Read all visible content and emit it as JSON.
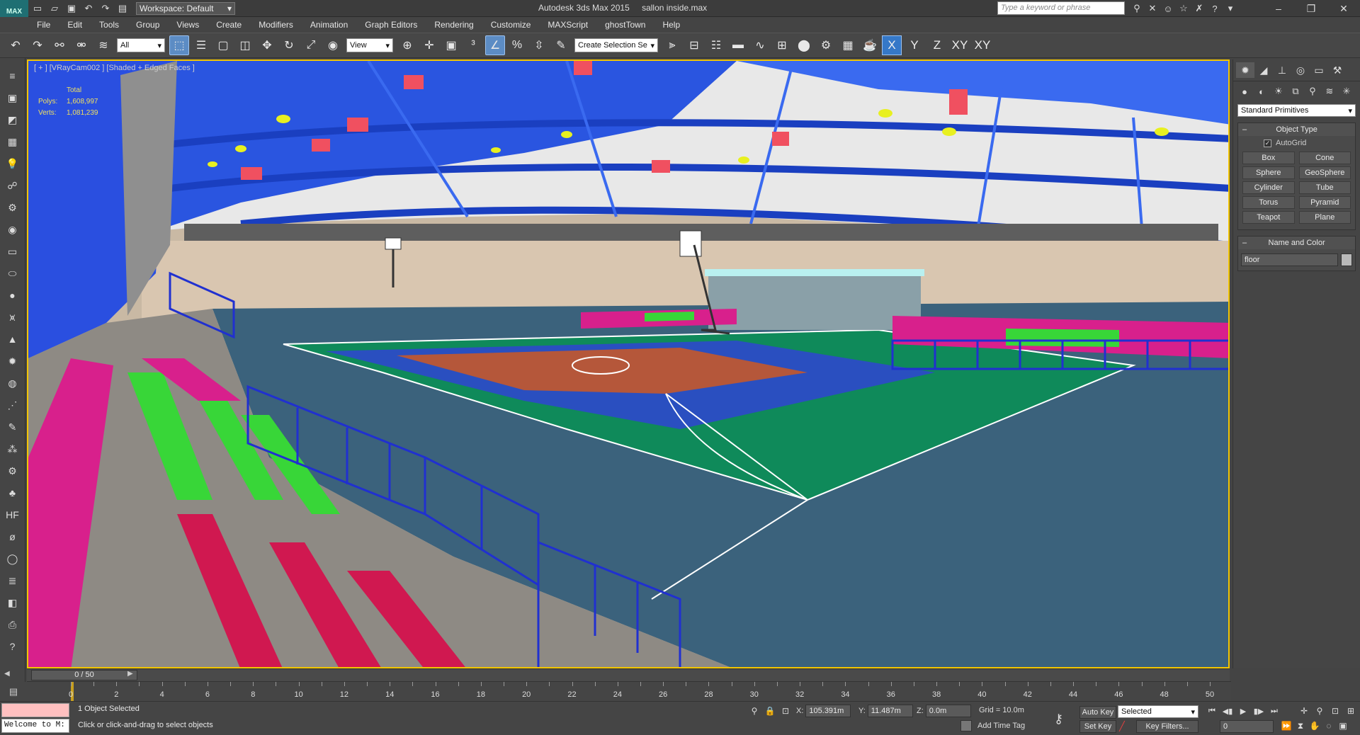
{
  "titlebar": {
    "workspace": "Workspace: Default",
    "app_title": "Autodesk 3ds Max 2015",
    "file_name": "sallon inside.max",
    "search_placeholder": "Type a keyword or phrase"
  },
  "menus": [
    "File",
    "Edit",
    "Tools",
    "Group",
    "Views",
    "Create",
    "Modifiers",
    "Animation",
    "Graph Editors",
    "Rendering",
    "Customize",
    "MAXScript",
    "ghostTown",
    "Help"
  ],
  "toolbar": {
    "filter_value": "All",
    "ref_coord_value": "View",
    "selection_set_value": "Create Selection Se",
    "axis_x": "X",
    "axis_y": "Y",
    "axis_z": "Z",
    "axis_xy": "XY",
    "axis_xy2": "XY"
  },
  "viewport": {
    "label": "[ + ] [VRayCam002 ] [Shaded + Edged Faces ]",
    "stats_header": "Total",
    "polys_label": "Polys:",
    "polys_value": "1,608,997",
    "verts_label": "Verts:",
    "verts_value": "1,081,239"
  },
  "command_panel": {
    "category_value": "Standard Primitives",
    "object_type_title": "Object Type",
    "autogrid_label": "AutoGrid",
    "autogrid_checked": true,
    "primitives": [
      "Box",
      "Cone",
      "Sphere",
      "GeoSphere",
      "Cylinder",
      "Tube",
      "Torus",
      "Pyramid",
      "Teapot",
      "Plane"
    ],
    "name_color_title": "Name and Color",
    "object_name": "floor"
  },
  "timeslider": {
    "frame_display": "0 / 50"
  },
  "trackbar": {
    "labels": [
      "0",
      "2",
      "4",
      "6",
      "8",
      "10",
      "12",
      "14",
      "16",
      "18",
      "20",
      "22",
      "24",
      "26",
      "28",
      "30",
      "32",
      "34",
      "36",
      "38",
      "40",
      "42",
      "44",
      "46",
      "48",
      "50"
    ]
  },
  "status": {
    "maxscript_text": "Welcome to M:",
    "selection": "1 Object Selected",
    "hint": "Click or click-and-drag to select objects",
    "x_label": "X:",
    "x_value": "105.391m",
    "y_label": "Y:",
    "y_value": "11.487m",
    "z_label": "Z:",
    "z_value": "0.0m",
    "grid": "Grid = 10.0m",
    "add_time_tag": "Add Time Tag",
    "auto_key": "Auto Key",
    "set_key": "Set Key",
    "key_mode_value": "Selected",
    "key_filters": "Key Filters...",
    "current_frame": "0"
  },
  "colors": {
    "viewport_border": "#f2c500",
    "active_tool": "#5c8cc4",
    "court_floor": "#3b627c",
    "court_green": "#0f8a5a",
    "court_blue": "#2a4fc0",
    "court_orange": "#b5573a",
    "roof_blue": "#1f4ee0",
    "seat_magenta": "#d8208c",
    "seat_green": "#38d638",
    "seat_red": "#d01850",
    "fence_blue": "#2030d0"
  }
}
